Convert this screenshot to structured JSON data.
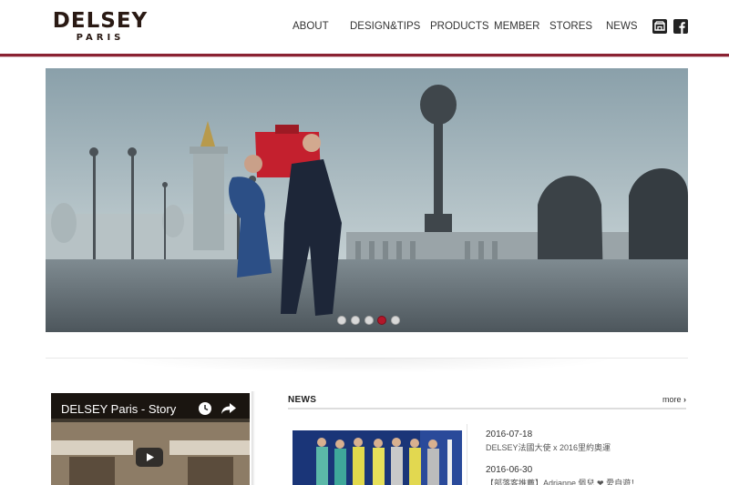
{
  "header": {
    "logo_main": "DELSEY",
    "logo_sub": "PARIS",
    "nav": [
      {
        "label": "ABOUT"
      },
      {
        "label": "DESIGN&TIPS"
      },
      {
        "label": "PRODUCTS"
      },
      {
        "label": "MEMBER"
      },
      {
        "label": "STORES"
      },
      {
        "label": "NEWS"
      }
    ],
    "icons": [
      "store-icon",
      "facebook-icon"
    ],
    "accent_color": "#8a2232"
  },
  "hero": {
    "slide_count": 5,
    "active_slide": 4,
    "active_dot_color": "#b3172a"
  },
  "video": {
    "title": "DELSEY Paris - Story",
    "icons": [
      "clock-icon",
      "share-icon",
      "play-icon"
    ]
  },
  "news": {
    "heading": "NEWS",
    "more_label": "more",
    "items": [
      {
        "date": "2016-07-18",
        "text": "DELSEY法國大使 x 2016里約奧運"
      },
      {
        "date": "2016-06-30",
        "text": "【部落客推薦】Adrianne 佩兒 ❤ 愛自遊！"
      }
    ]
  }
}
